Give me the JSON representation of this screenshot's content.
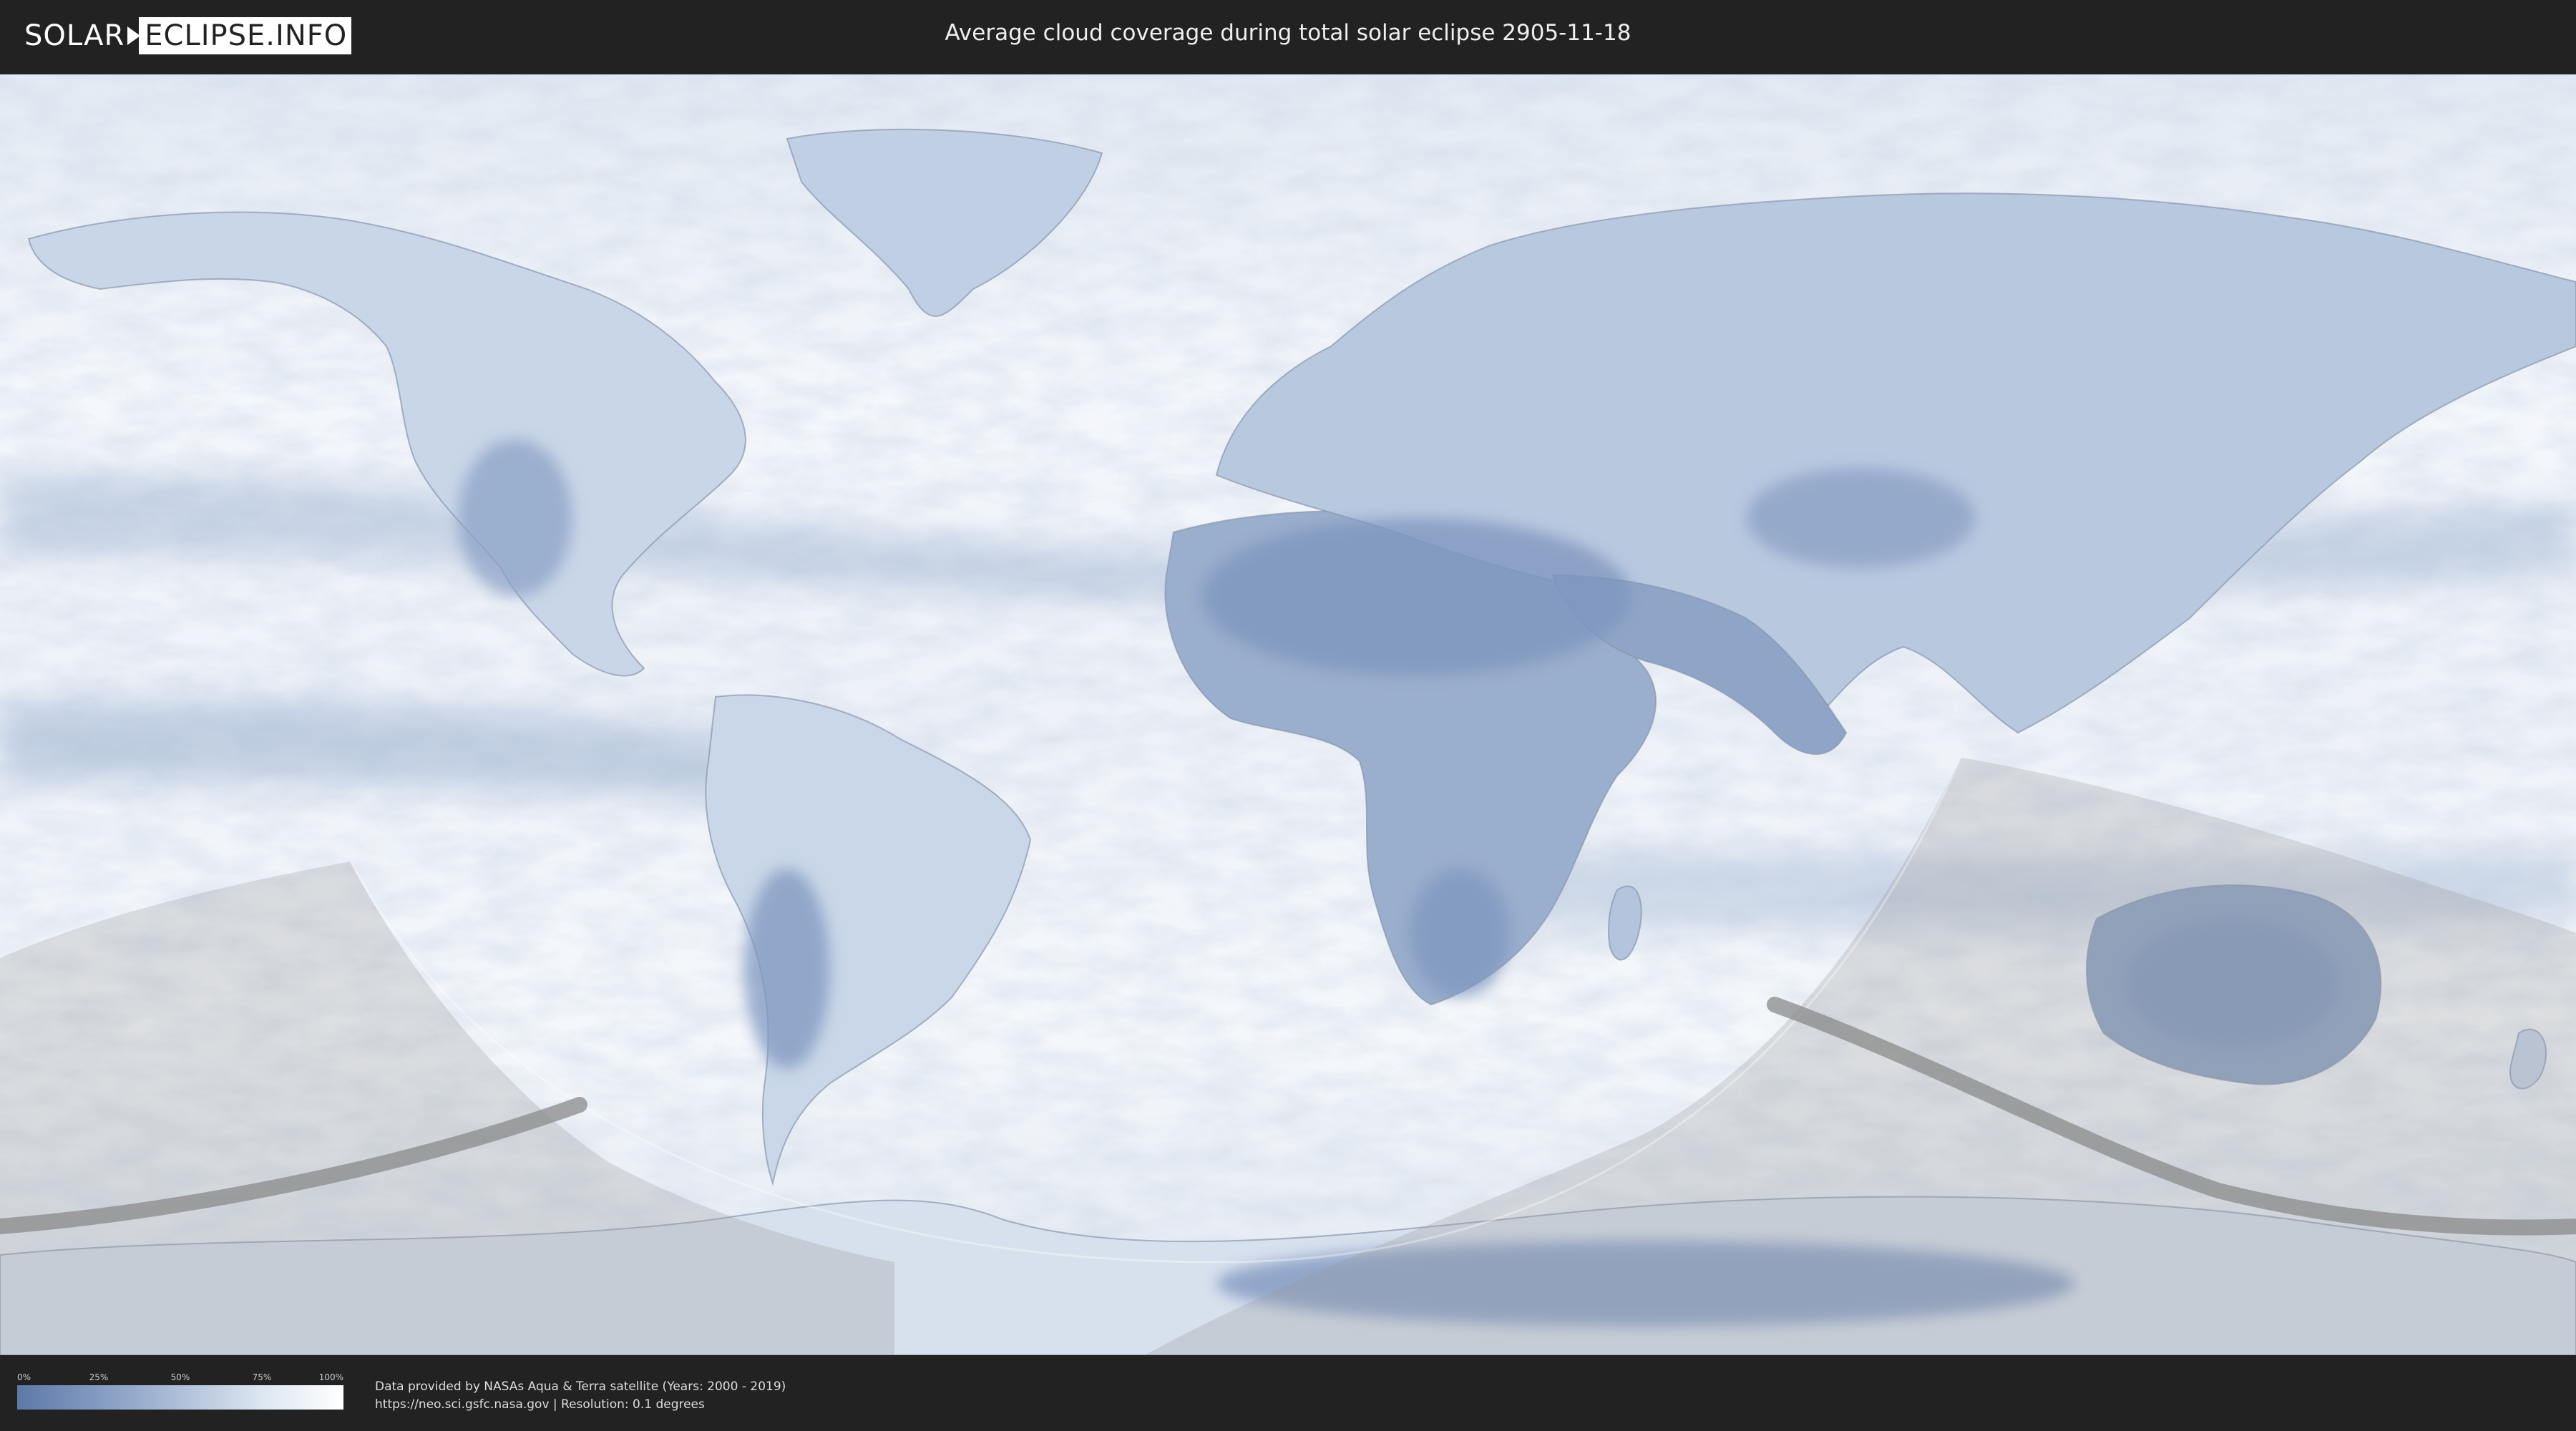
{
  "header": {
    "logo_part1": "SOLAR",
    "logo_part2": "ECLIPSE.INFO",
    "title": "Average cloud coverage during total solar eclipse 2905-11-18"
  },
  "map": {
    "layer": "cloud-coverage",
    "colors": {
      "ocean_cloudy": "#f2f5f9",
      "clear_sky": "#5d79a8",
      "night_shade": "#9a9a9a",
      "eclipse_path": "#8a8a8a"
    }
  },
  "legend": {
    "ticks": [
      "0%",
      "25%",
      "50%",
      "75%",
      "100%"
    ],
    "gradient": [
      "#5d79a8",
      "#9cb0cf",
      "#dde6f1",
      "#ffffff"
    ]
  },
  "footer": {
    "line1": "Data provided by NASAs Aqua & Terra satellite (Years: 2000 - 2019)",
    "line2": "https://neo.sci.gsfc.nasa.gov | Resolution: 0.1 degrees"
  }
}
